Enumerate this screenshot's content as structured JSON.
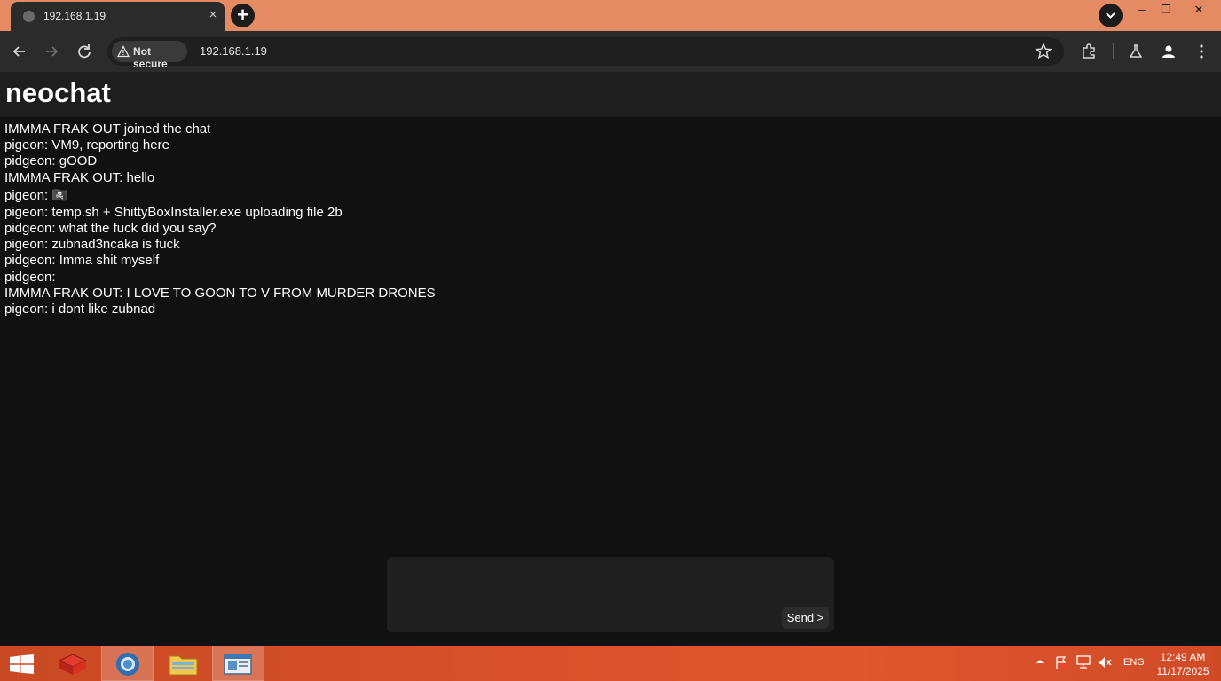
{
  "browser": {
    "tab_title": "192.168.1.19",
    "tab_close": "×",
    "new_tab": "+",
    "security_label": "Not secure",
    "url": "192.168.1.19",
    "win_minimize": "–",
    "win_restore": "❐",
    "win_close": "✕"
  },
  "app": {
    "title": "neochat",
    "messages": [
      "IMMMA FRAK OUT joined the chat",
      "pigeon: VM9, reporting here",
      "pidgeon: gOOD",
      "IMMMA FRAK OUT: hello",
      "pigeon: 🏴‍☠️",
      "pigeon: temp.sh + ShittyBoxInstaller.exe uploading file 2b",
      "pidgeon: what the fuck did you say?",
      "pigeon: zubnad3ncaka is fuck",
      "pidgeon: Imma shit myself",
      "pidgeon:",
      "IMMMA FRAK OUT: I LOVE TO GOON TO V FROM MURDER DRONES",
      "pigeon: i dont like zubnad"
    ],
    "composer": {
      "value": "",
      "send_label": "Send >"
    }
  },
  "taskbar": {
    "language": "ENG",
    "time": "12:49 AM",
    "date": "11/17/2025"
  }
}
